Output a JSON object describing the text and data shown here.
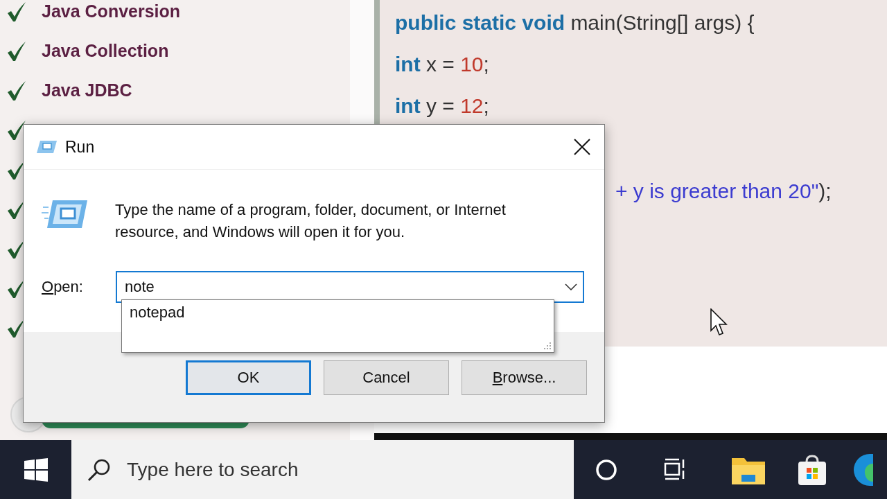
{
  "topics": [
    {
      "kind": "labeled",
      "label": "Java Conversion"
    },
    {
      "kind": "labeled",
      "label": "Java Collection"
    },
    {
      "kind": "labeled",
      "label": "Java JDBC"
    },
    {
      "kind": "check_only"
    },
    {
      "kind": "check_only"
    },
    {
      "kind": "check_only"
    },
    {
      "kind": "check_only"
    },
    {
      "kind": "check_only"
    },
    {
      "kind": "check_only"
    }
  ],
  "code_lines": [
    {
      "kind": "full",
      "tokens": [
        {
          "kind": "keyword",
          "text": "public static void"
        },
        {
          "kind": "plain",
          "text": " main(String[] args) {"
        }
      ]
    },
    {
      "kind": "full",
      "tokens": [
        {
          "kind": "keyword",
          "text": "int"
        },
        {
          "kind": "plain",
          "text": " x = "
        },
        {
          "kind": "number",
          "text": "10"
        },
        {
          "kind": "plain",
          "text": ";"
        }
      ]
    },
    {
      "kind": "full",
      "tokens": [
        {
          "kind": "keyword",
          "text": "int"
        },
        {
          "kind": "plain",
          "text": " y = "
        },
        {
          "kind": "number",
          "text": "12"
        },
        {
          "kind": "plain",
          "text": ";"
        }
      ]
    },
    {
      "kind": "partial",
      "tokens": [
        {
          "kind": "string",
          "text": "+ y is greater than 20\""
        },
        {
          "kind": "plain",
          "text": ");"
        }
      ]
    }
  ],
  "dialog": {
    "title": "Run",
    "message": "Type the name of a program, folder, document, or Internet resource, and Windows will open it for you.",
    "open_label": "Open:",
    "open_value": "note",
    "suggestions": [
      "notepad"
    ],
    "buttons": [
      {
        "label": "OK",
        "default": true
      },
      {
        "label": "Cancel",
        "default": false
      },
      {
        "label": "Browse...",
        "default": false
      }
    ]
  },
  "taskbar": {
    "search": {
      "placeholder": "Type here to search"
    }
  }
}
